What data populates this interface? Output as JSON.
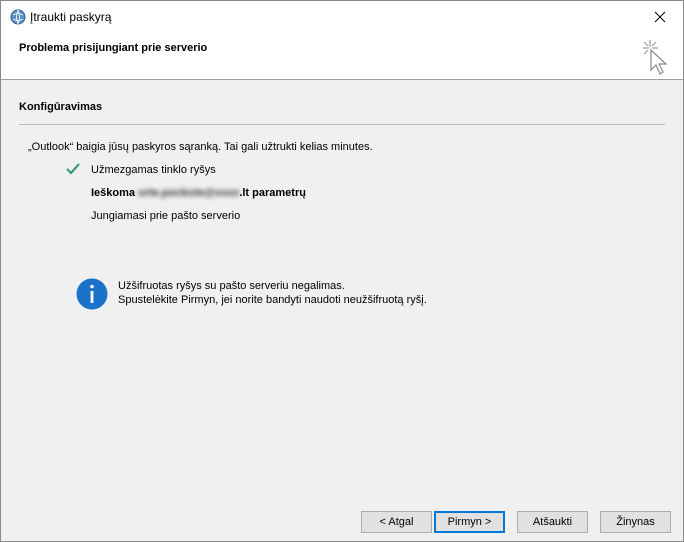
{
  "window": {
    "title": "Įtraukti paskyrą"
  },
  "header": {
    "title": "Problema prisijungiant prie serverio"
  },
  "section": {
    "title": "Konfigūravimas"
  },
  "intro": "„Outlook“ baigia jūsų paskyros sąranką. Tai gali užtrukti kelias minutes.",
  "steps": {
    "network": "Užmezgamas tinklo ryšys",
    "search_prefix": "Ieškoma",
    "search_email_blurred": "urte.pockute@xxxx",
    "search_suffix": ".lt parametrų",
    "connect": "Jungiamasi prie pašto serverio"
  },
  "info": {
    "line1": "Užšifruotas ryšys su pašto serveriu negalimas.",
    "line2": "Spustelėkite Pirmyn, jei norite bandyti naudoti neužšifruotą ryšį."
  },
  "buttons": {
    "back": "< Atgal",
    "next": "Pirmyn >",
    "cancel": "Atšaukti",
    "help": "Žinynas"
  },
  "colors": {
    "check": "#3a9a6d",
    "info": "#1a73c8",
    "default_button_border": "#0078d7"
  },
  "icons": {
    "app": "outlook-globe-icon",
    "header": "sparkle-cursor-icon",
    "close": "close-icon",
    "check": "checkmark-icon",
    "info": "info-icon"
  }
}
